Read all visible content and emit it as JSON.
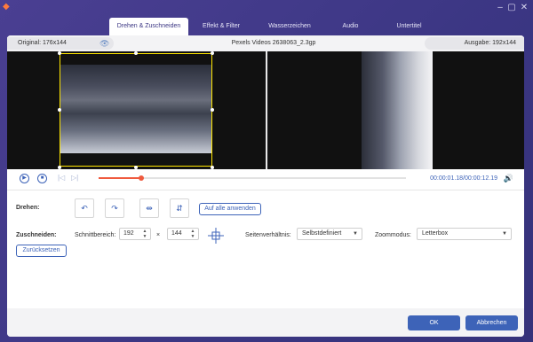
{
  "window": {
    "minimize_icon": "minimize-icon",
    "maximize_icon": "maximize-icon",
    "close_icon": "close-icon"
  },
  "tabs": [
    {
      "label": "Drehen & Zuschneiden",
      "active": true
    },
    {
      "label": "Effekt & Filter",
      "active": false
    },
    {
      "label": "Wasserzeichen",
      "active": false
    },
    {
      "label": "Audio",
      "active": false
    },
    {
      "label": "Untertitel",
      "active": false
    }
  ],
  "info": {
    "original": "Original: 176x144",
    "filename": "Pexels Videos 2638063_2.3gp",
    "output": "Ausgabe: 192x144"
  },
  "player": {
    "time": "00:00:01.18/00:00:12.19",
    "progress": 0.14
  },
  "rotate": {
    "label": "Drehen:",
    "apply_all": "Auf alle anwenden"
  },
  "crop": {
    "label": "Zuschneiden:",
    "area_label": "Schnittbereich:",
    "width": "192",
    "times": "×",
    "height": "144",
    "aspect_label": "Seitenverhältnis:",
    "aspect_value": "Selbstdefiniert",
    "zoom_label": "Zoommodus:",
    "zoom_value": "Letterbox",
    "reset": "Zurücksetzen"
  },
  "footer": {
    "ok": "OK",
    "cancel": "Abbrechen"
  },
  "colors": {
    "accent": "#3d63b8",
    "progress": "#ef5a3e",
    "frame": "#ffe600",
    "background": "#3b3683"
  }
}
